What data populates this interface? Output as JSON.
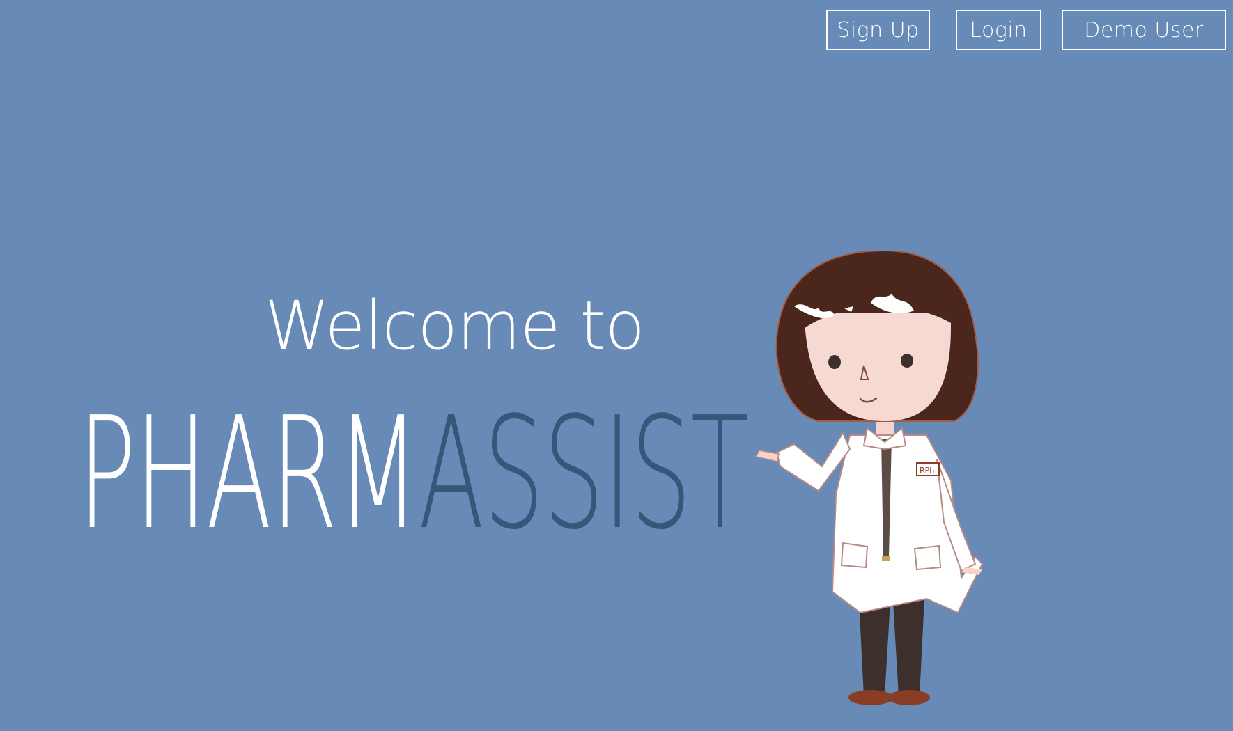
{
  "nav": {
    "signup_label": "Sign Up",
    "login_label": "Login",
    "demo_label": "Demo User"
  },
  "hero": {
    "welcome_text": "Welcome to",
    "brand_part1": "PHARM",
    "brand_part2": "ASSIST"
  },
  "badge_text": "RPh",
  "colors": {
    "background": "#678bb6",
    "brand_light": "#ffffff",
    "brand_dark": "#365779",
    "hair": "#4a261c"
  }
}
